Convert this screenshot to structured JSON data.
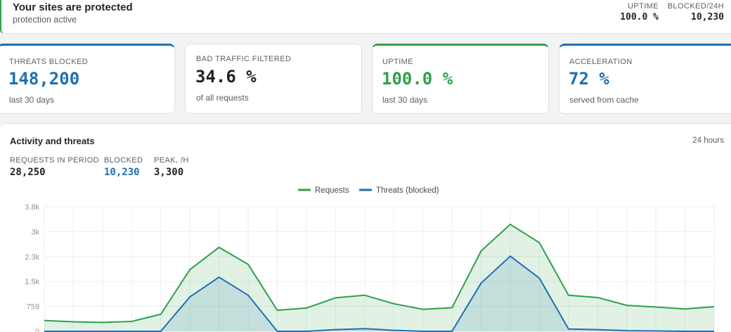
{
  "status": {
    "title": "Your sites are protected",
    "subtitle": "protection active",
    "uptime_label": "UPTIME",
    "uptime_value": "100.0 %",
    "blocked_label": "BLOCKED/24H",
    "blocked_value": "10,230"
  },
  "cards": [
    {
      "label": "THREATS BLOCKED",
      "value": "148,200",
      "sub": "last 30 days",
      "color": "#1f6fb0"
    },
    {
      "label": "BAD TRAFFIC FILTERED",
      "value": "34.6 %",
      "sub": "of all requests",
      "color": "#1f2328"
    },
    {
      "label": "UPTIME",
      "value": "100.0 %",
      "sub": "last 30 days",
      "color": "#2ea04a"
    },
    {
      "label": "ACCELERATION",
      "value": "72 %",
      "sub": "served from cache",
      "color": "#1f6fb0"
    }
  ],
  "activity": {
    "title": "Activity and threats",
    "range": "24 hours",
    "kpis": [
      {
        "label": "REQUESTS IN PERIOD",
        "value": "28,250"
      },
      {
        "label": "BLOCKED",
        "value": "10,230"
      },
      {
        "label": "PEAK, /H",
        "value": "3,300"
      }
    ]
  },
  "colors": {
    "requests": "#2ea04a",
    "threats": "#1f6fb0",
    "accent_green": "#2ea04a",
    "accent_blue": "#1f6fb0"
  },
  "chart_data": {
    "type": "area",
    "title": "",
    "xlabel": "",
    "ylabel": "",
    "y_tick_labels": [
      "0",
      "759",
      "1.5k",
      "2.3k",
      "3k",
      "3.8k"
    ],
    "y_ticks": [
      0,
      759,
      1518,
      2277,
      3036,
      3795
    ],
    "ylim": [
      0,
      3795
    ],
    "x": [
      0,
      1,
      2,
      3,
      4,
      5,
      6,
      7,
      8,
      9,
      10,
      11,
      12,
      13,
      14,
      15,
      16,
      17,
      18,
      19,
      20,
      21,
      22,
      23
    ],
    "legend_placement": "top-center",
    "grid": true,
    "series": [
      {
        "name": "Requests",
        "values": [
          330,
          290,
          270,
          300,
          520,
          1880,
          2560,
          2040,
          640,
          710,
          1020,
          1100,
          840,
          670,
          720,
          2450,
          3260,
          2700,
          1100,
          1030,
          790,
          740,
          680,
          750
        ]
      },
      {
        "name": "Threats (blocked)",
        "values": [
          0,
          0,
          0,
          0,
          0,
          1050,
          1650,
          1100,
          0,
          0,
          50,
          80,
          30,
          0,
          0,
          1470,
          2290,
          1620,
          70,
          50,
          20,
          10,
          0,
          0
        ]
      }
    ]
  }
}
